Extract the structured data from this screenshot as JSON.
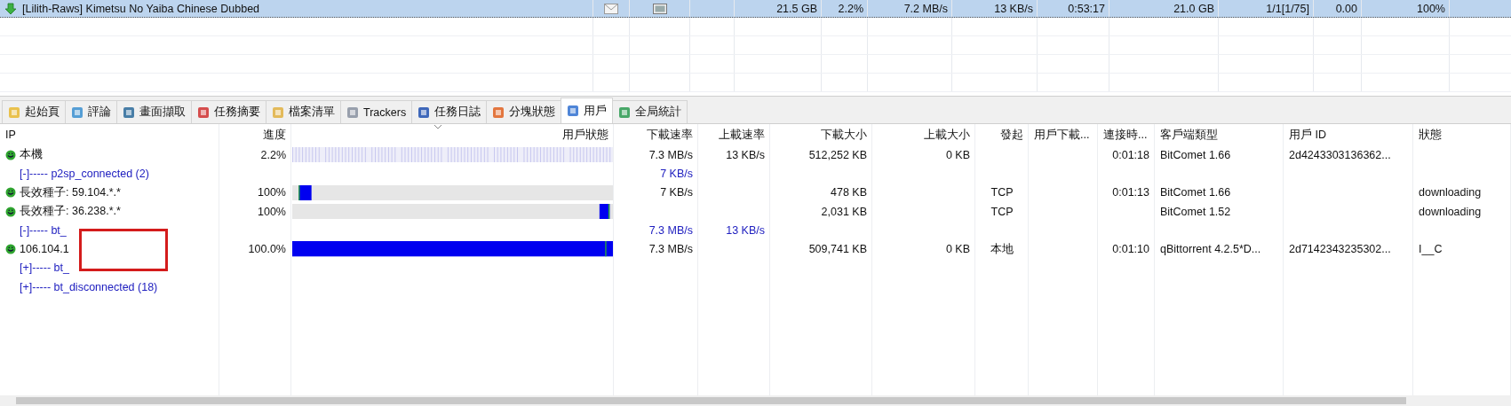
{
  "torrents": [
    {
      "name": "[Lilith-Raws] Kimetsu No Yaiba Chinese Dubbed",
      "selected": true,
      "size": "21.5 GB",
      "progress": "2.2%",
      "download_rate": "7.2 MB/s",
      "upload_rate": "13 KB/s",
      "time_left": "0:53:17",
      "downloaded": "21.0 GB",
      "seeds_peers": "1/1[1/75]",
      "ratio": "0.00",
      "health": "100%"
    }
  ],
  "tabs": [
    {
      "label": "起始頁",
      "selected": false
    },
    {
      "label": "評論",
      "selected": false
    },
    {
      "label": "畫面擷取",
      "selected": false
    },
    {
      "label": "任務摘要",
      "selected": false
    },
    {
      "label": "檔案清單",
      "selected": false
    },
    {
      "label": "Trackers",
      "selected": false
    },
    {
      "label": "任務日誌",
      "selected": false
    },
    {
      "label": "分塊狀態",
      "selected": false
    },
    {
      "label": "用戶",
      "selected": true
    },
    {
      "label": "全局統計",
      "selected": false
    }
  ],
  "peers": {
    "columns": [
      "IP",
      "進度",
      "用戶狀態",
      "下載速率",
      "上載速率",
      "下載大小",
      "上載大小",
      "發起",
      "用戶下載...",
      "連接時...",
      "客戶端類型",
      "用戶 ID",
      "狀態"
    ],
    "rows": [
      {
        "kind": "peer",
        "bar": {
          "kind": "sparse"
        },
        "cells": [
          "本機",
          "2.2%",
          "",
          "7.3 MB/s",
          "13 KB/s",
          "512,252 KB",
          "0 KB",
          "",
          "",
          "0:01:18",
          "BitComet 1.66",
          "2d4243303136362...",
          ""
        ]
      },
      {
        "kind": "group",
        "cells": [
          "[-]----- p2sp_connected (2)",
          "",
          "",
          "7 KB/s",
          "",
          "",
          "",
          "",
          "",
          "",
          "",
          "",
          ""
        ]
      },
      {
        "kind": "peer",
        "bar": {
          "kind": "head"
        },
        "cells": [
          "長效種子: 59.104.*.*",
          "100%",
          "",
          "7 KB/s",
          "",
          "478 KB",
          "",
          "TCP",
          "",
          "0:01:13",
          "BitComet 1.66",
          "",
          "downloading"
        ]
      },
      {
        "kind": "peer",
        "bar": {
          "kind": "tail"
        },
        "cells": [
          "長效種子: 36.238.*.*",
          "100%",
          "",
          "",
          "",
          "2,031 KB",
          "",
          "TCP",
          "",
          "",
          "BitComet 1.52",
          "",
          "downloading"
        ]
      },
      {
        "kind": "group",
        "cells": [
          "[-]----- bt_",
          "",
          "",
          "7.3 MB/s",
          "13 KB/s",
          "",
          "",
          "",
          "",
          "",
          "",
          "",
          ""
        ]
      },
      {
        "kind": "peer",
        "bar": {
          "kind": "full"
        },
        "cells": [
          "106.104.1",
          "100.0%",
          "",
          "7.3 MB/s",
          "",
          "509,741 KB",
          "0 KB",
          "本地",
          "",
          "0:01:10",
          "qBittorrent 4.2.5*D...",
          "2d7142343235302...",
          "I__C"
        ]
      },
      {
        "kind": "group",
        "cells": [
          "[+]----- bt_",
          "",
          "",
          "",
          "",
          "",
          "",
          "",
          "",
          "",
          "",
          "",
          ""
        ]
      },
      {
        "kind": "group",
        "cells": [
          "[+]----- bt_disconnected (18)",
          "",
          "",
          "",
          "",
          "",
          "",
          "",
          "",
          "",
          "",
          "",
          ""
        ]
      }
    ]
  }
}
